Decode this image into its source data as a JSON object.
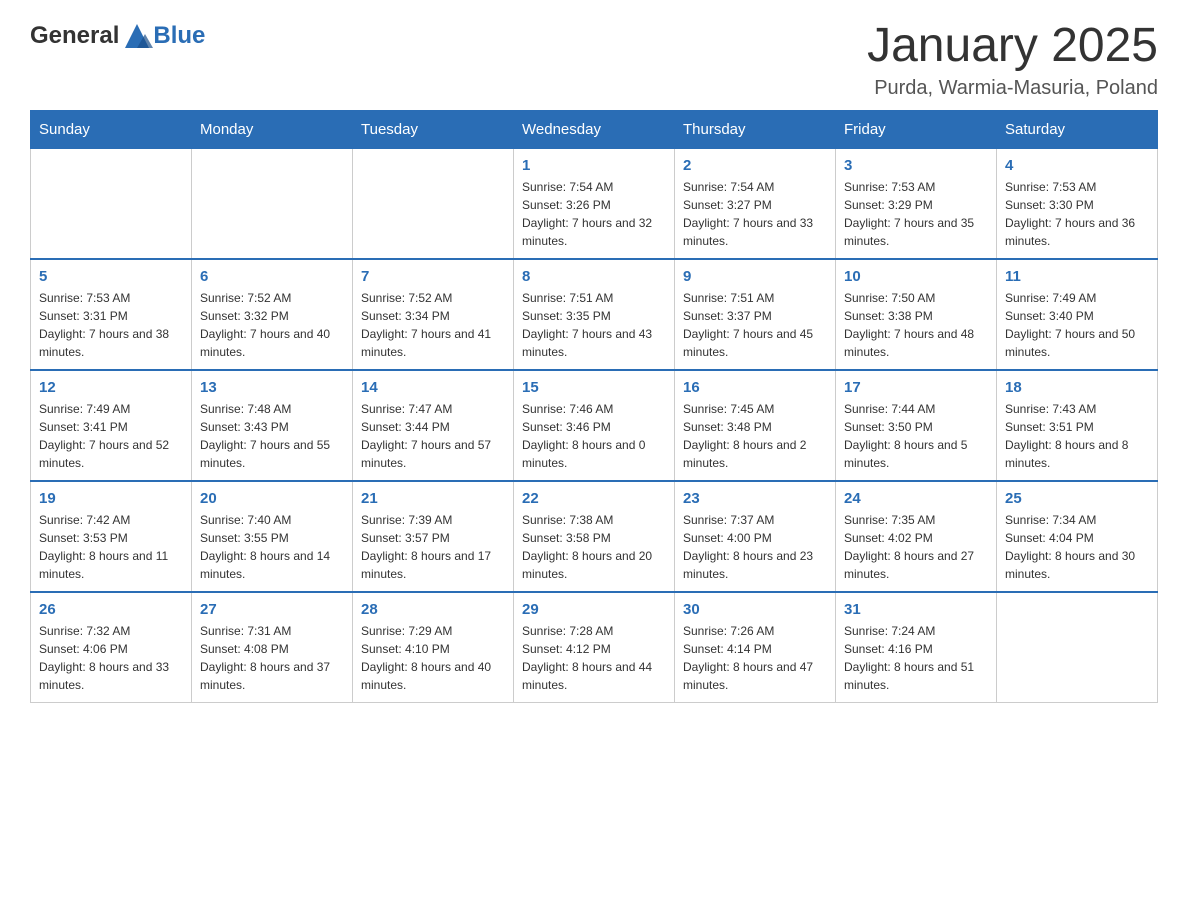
{
  "header": {
    "logo_text_general": "General",
    "logo_text_blue": "Blue",
    "title": "January 2025",
    "location": "Purda, Warmia-Masuria, Poland"
  },
  "days_of_week": [
    "Sunday",
    "Monday",
    "Tuesday",
    "Wednesday",
    "Thursday",
    "Friday",
    "Saturday"
  ],
  "weeks": [
    [
      {
        "day": "",
        "sunrise": "",
        "sunset": "",
        "daylight": ""
      },
      {
        "day": "",
        "sunrise": "",
        "sunset": "",
        "daylight": ""
      },
      {
        "day": "",
        "sunrise": "",
        "sunset": "",
        "daylight": ""
      },
      {
        "day": "1",
        "sunrise": "Sunrise: 7:54 AM",
        "sunset": "Sunset: 3:26 PM",
        "daylight": "Daylight: 7 hours and 32 minutes."
      },
      {
        "day": "2",
        "sunrise": "Sunrise: 7:54 AM",
        "sunset": "Sunset: 3:27 PM",
        "daylight": "Daylight: 7 hours and 33 minutes."
      },
      {
        "day": "3",
        "sunrise": "Sunrise: 7:53 AM",
        "sunset": "Sunset: 3:29 PM",
        "daylight": "Daylight: 7 hours and 35 minutes."
      },
      {
        "day": "4",
        "sunrise": "Sunrise: 7:53 AM",
        "sunset": "Sunset: 3:30 PM",
        "daylight": "Daylight: 7 hours and 36 minutes."
      }
    ],
    [
      {
        "day": "5",
        "sunrise": "Sunrise: 7:53 AM",
        "sunset": "Sunset: 3:31 PM",
        "daylight": "Daylight: 7 hours and 38 minutes."
      },
      {
        "day": "6",
        "sunrise": "Sunrise: 7:52 AM",
        "sunset": "Sunset: 3:32 PM",
        "daylight": "Daylight: 7 hours and 40 minutes."
      },
      {
        "day": "7",
        "sunrise": "Sunrise: 7:52 AM",
        "sunset": "Sunset: 3:34 PM",
        "daylight": "Daylight: 7 hours and 41 minutes."
      },
      {
        "day": "8",
        "sunrise": "Sunrise: 7:51 AM",
        "sunset": "Sunset: 3:35 PM",
        "daylight": "Daylight: 7 hours and 43 minutes."
      },
      {
        "day": "9",
        "sunrise": "Sunrise: 7:51 AM",
        "sunset": "Sunset: 3:37 PM",
        "daylight": "Daylight: 7 hours and 45 minutes."
      },
      {
        "day": "10",
        "sunrise": "Sunrise: 7:50 AM",
        "sunset": "Sunset: 3:38 PM",
        "daylight": "Daylight: 7 hours and 48 minutes."
      },
      {
        "day": "11",
        "sunrise": "Sunrise: 7:49 AM",
        "sunset": "Sunset: 3:40 PM",
        "daylight": "Daylight: 7 hours and 50 minutes."
      }
    ],
    [
      {
        "day": "12",
        "sunrise": "Sunrise: 7:49 AM",
        "sunset": "Sunset: 3:41 PM",
        "daylight": "Daylight: 7 hours and 52 minutes."
      },
      {
        "day": "13",
        "sunrise": "Sunrise: 7:48 AM",
        "sunset": "Sunset: 3:43 PM",
        "daylight": "Daylight: 7 hours and 55 minutes."
      },
      {
        "day": "14",
        "sunrise": "Sunrise: 7:47 AM",
        "sunset": "Sunset: 3:44 PM",
        "daylight": "Daylight: 7 hours and 57 minutes."
      },
      {
        "day": "15",
        "sunrise": "Sunrise: 7:46 AM",
        "sunset": "Sunset: 3:46 PM",
        "daylight": "Daylight: 8 hours and 0 minutes."
      },
      {
        "day": "16",
        "sunrise": "Sunrise: 7:45 AM",
        "sunset": "Sunset: 3:48 PM",
        "daylight": "Daylight: 8 hours and 2 minutes."
      },
      {
        "day": "17",
        "sunrise": "Sunrise: 7:44 AM",
        "sunset": "Sunset: 3:50 PM",
        "daylight": "Daylight: 8 hours and 5 minutes."
      },
      {
        "day": "18",
        "sunrise": "Sunrise: 7:43 AM",
        "sunset": "Sunset: 3:51 PM",
        "daylight": "Daylight: 8 hours and 8 minutes."
      }
    ],
    [
      {
        "day": "19",
        "sunrise": "Sunrise: 7:42 AM",
        "sunset": "Sunset: 3:53 PM",
        "daylight": "Daylight: 8 hours and 11 minutes."
      },
      {
        "day": "20",
        "sunrise": "Sunrise: 7:40 AM",
        "sunset": "Sunset: 3:55 PM",
        "daylight": "Daylight: 8 hours and 14 minutes."
      },
      {
        "day": "21",
        "sunrise": "Sunrise: 7:39 AM",
        "sunset": "Sunset: 3:57 PM",
        "daylight": "Daylight: 8 hours and 17 minutes."
      },
      {
        "day": "22",
        "sunrise": "Sunrise: 7:38 AM",
        "sunset": "Sunset: 3:58 PM",
        "daylight": "Daylight: 8 hours and 20 minutes."
      },
      {
        "day": "23",
        "sunrise": "Sunrise: 7:37 AM",
        "sunset": "Sunset: 4:00 PM",
        "daylight": "Daylight: 8 hours and 23 minutes."
      },
      {
        "day": "24",
        "sunrise": "Sunrise: 7:35 AM",
        "sunset": "Sunset: 4:02 PM",
        "daylight": "Daylight: 8 hours and 27 minutes."
      },
      {
        "day": "25",
        "sunrise": "Sunrise: 7:34 AM",
        "sunset": "Sunset: 4:04 PM",
        "daylight": "Daylight: 8 hours and 30 minutes."
      }
    ],
    [
      {
        "day": "26",
        "sunrise": "Sunrise: 7:32 AM",
        "sunset": "Sunset: 4:06 PM",
        "daylight": "Daylight: 8 hours and 33 minutes."
      },
      {
        "day": "27",
        "sunrise": "Sunrise: 7:31 AM",
        "sunset": "Sunset: 4:08 PM",
        "daylight": "Daylight: 8 hours and 37 minutes."
      },
      {
        "day": "28",
        "sunrise": "Sunrise: 7:29 AM",
        "sunset": "Sunset: 4:10 PM",
        "daylight": "Daylight: 8 hours and 40 minutes."
      },
      {
        "day": "29",
        "sunrise": "Sunrise: 7:28 AM",
        "sunset": "Sunset: 4:12 PM",
        "daylight": "Daylight: 8 hours and 44 minutes."
      },
      {
        "day": "30",
        "sunrise": "Sunrise: 7:26 AM",
        "sunset": "Sunset: 4:14 PM",
        "daylight": "Daylight: 8 hours and 47 minutes."
      },
      {
        "day": "31",
        "sunrise": "Sunrise: 7:24 AM",
        "sunset": "Sunset: 4:16 PM",
        "daylight": "Daylight: 8 hours and 51 minutes."
      },
      {
        "day": "",
        "sunrise": "",
        "sunset": "",
        "daylight": ""
      }
    ]
  ]
}
